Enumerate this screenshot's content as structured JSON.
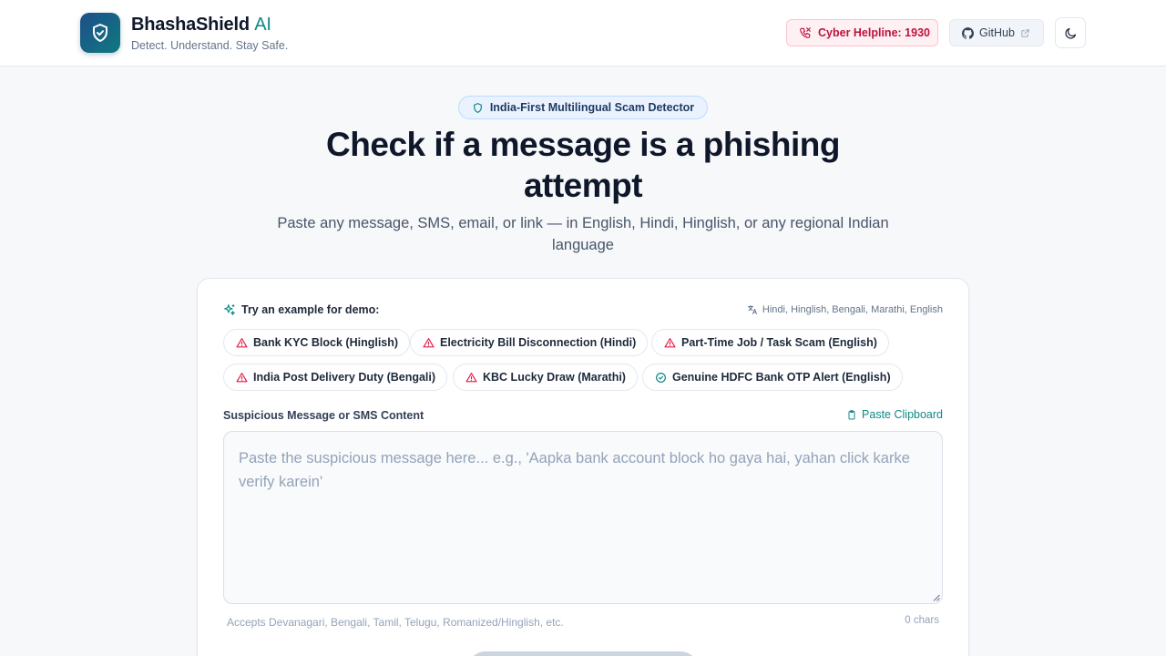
{
  "header": {
    "brand_name": "BhashaShield",
    "brand_ai": "AI",
    "tagline": "Detect. Understand. Stay Safe.",
    "helpline_label": "Cyber Helpline: 1930",
    "github_label": "GitHub",
    "logo_icon": "shield-check-icon",
    "theme_icon": "moon-icon"
  },
  "hero": {
    "badge": "India-First Multilingual Scam Detector",
    "title": "Check if a message is a phishing attempt",
    "subtitle": "Paste any message, SMS, email, or link — in English, Hindi, Hinglish, or any regional Indian language"
  },
  "demo": {
    "label": "Try an example for demo:",
    "languages": "Hindi, Hinglish, Bengali, Marathi, English",
    "examples": [
      {
        "label": "Bank KYC Block (Hinglish)",
        "icon": "warning-icon"
      },
      {
        "label": "Electricity Bill Disconnection (Hindi)",
        "icon": "warning-icon"
      },
      {
        "label": "Part-Time Job / Task Scam (English)",
        "icon": "warning-icon"
      },
      {
        "label": "India Post Delivery Duty (Bengali)",
        "icon": "warning-icon"
      },
      {
        "label": "KBC Lucky Draw (Marathi)",
        "icon": "warning-icon"
      },
      {
        "label": "Genuine HDFC Bank OTP Alert (English)",
        "icon": "check-circle-icon"
      }
    ]
  },
  "message": {
    "label": "Suspicious Message or SMS Content",
    "paste_label": "Paste Clipboard",
    "value": "",
    "placeholder": "Paste the suspicious message here... e.g., 'Aapka bank account block ho gaya hai, yahan click karke verify karein'",
    "accepts": "Accepts Devanagari, Bengali, Tamil, Telugu, Romanized/Hinglish, etc.",
    "char_count": "0 chars"
  },
  "colors": {
    "accent": "#0f8a85",
    "danger": "#be123c",
    "brand_dark": "#1d4e89"
  }
}
